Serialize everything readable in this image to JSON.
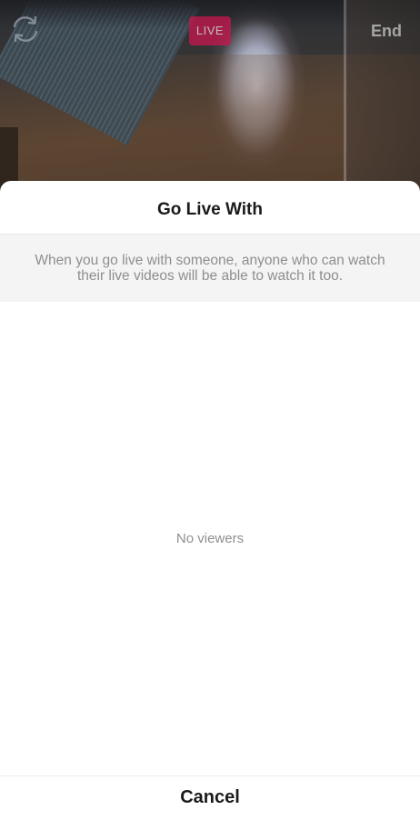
{
  "camera": {
    "flip_icon": "camera-flip-icon",
    "live_badge_label": "LIVE",
    "end_label": "End"
  },
  "sheet": {
    "title": "Go Live With",
    "info_text": "When you go live with someone, anyone who can watch their live videos will be able to watch it too.",
    "empty_state": "No viewers",
    "cancel_label": "Cancel"
  },
  "colors": {
    "live_badge": "#c8174f",
    "sheet_background": "#ffffff",
    "info_background": "#f4f4f4",
    "muted_text": "#8e8e8e"
  }
}
